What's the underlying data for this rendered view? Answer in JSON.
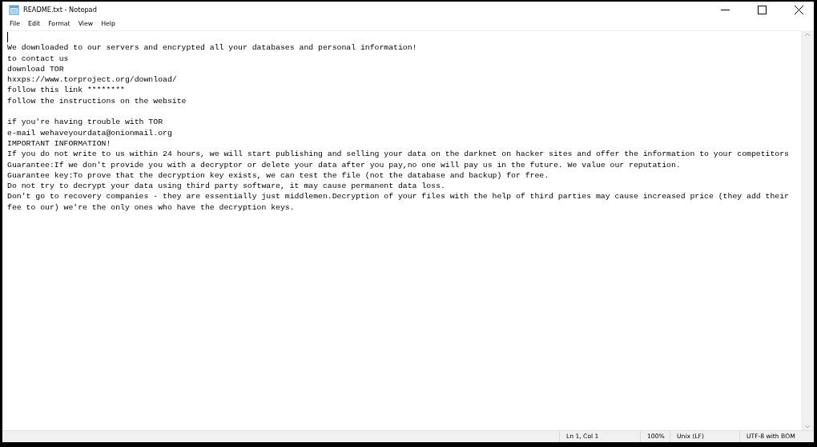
{
  "window": {
    "title": "README.txt - Notepad"
  },
  "menu": [
    "File",
    "Edit",
    "Format",
    "View",
    "Help"
  ],
  "document": {
    "caret": true,
    "blocks": [
      [
        "We downloaded to our servers and encrypted all your databases and personal information!",
        "to contact us",
        "download TOR",
        "hxxps://www.torproject.org/download/",
        "follow this link ********",
        "follow the instructions on the website"
      ],
      [
        "if you're having trouble with TOR",
        "e-mail wehaveyourdata@onionmail.org",
        "IMPORTANT INFORMATION!",
        "If you do not write to us within 24 hours, we will start publishing and selling your data on the darknet on hacker sites and offer the information to your competitors",
        "Guarantee:If we don't provide you with a decryptor or delete your data after you pay,no one will pay us in the future. We value our reputation.",
        "Guarantee key:To prove that the decryption key exists, we can test the file (not the database and backup) for free.",
        "Do not try to decrypt your data using third party software, it may cause permanent data loss.",
        "Don't go to recovery companies - they are essentially just middlemen.Decryption of your files with the help of third parties may cause increased price (they add their",
        "fee to our) we're the only ones who have the decryption keys."
      ]
    ]
  },
  "status_bar": {
    "position": "Ln 1, Col 1",
    "zoom": "100%",
    "line_ending": "Unix (LF)",
    "encoding": "UTF-8 with BOM"
  }
}
